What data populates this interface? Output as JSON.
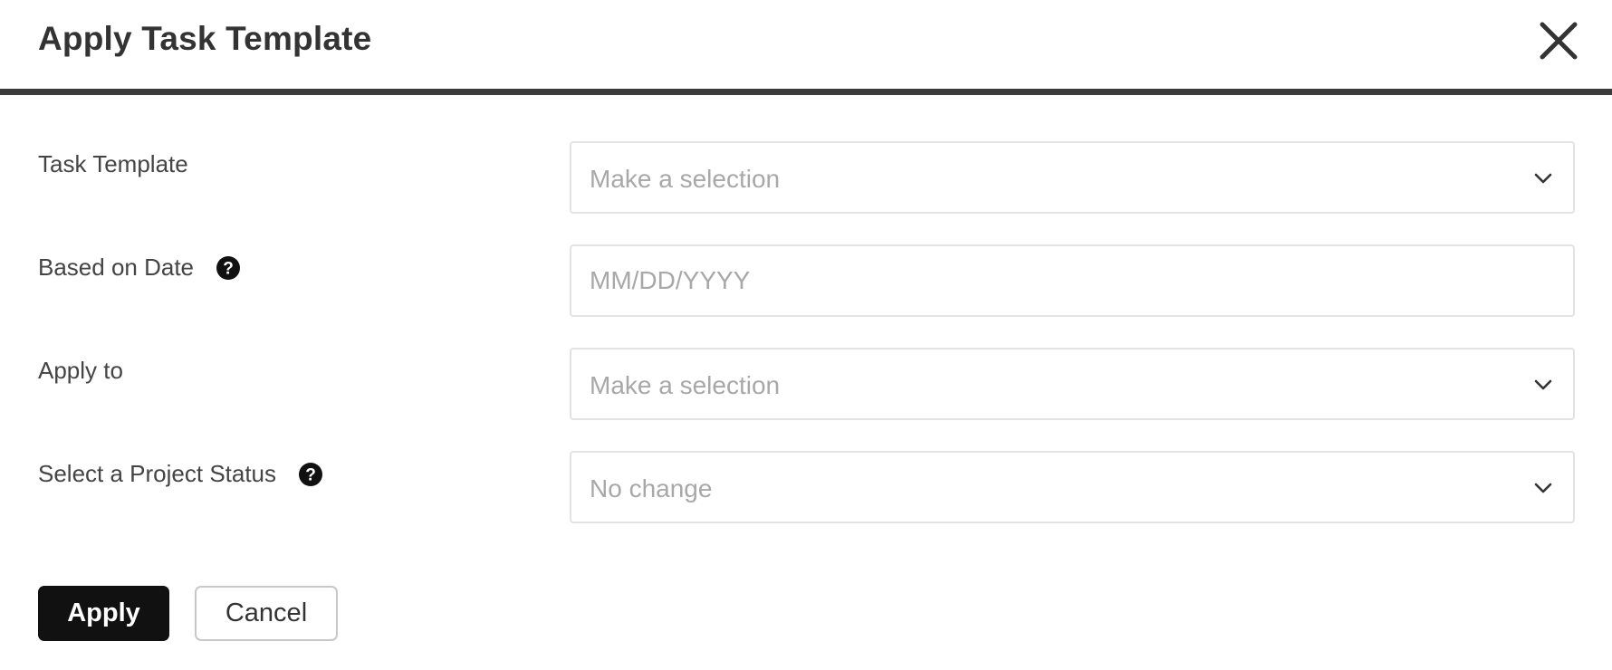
{
  "dialog": {
    "title": "Apply Task Template",
    "close_icon": "close-icon"
  },
  "form": {
    "fields": [
      {
        "label": "Task Template",
        "type": "select",
        "placeholder": "Make a selection",
        "has_help": false
      },
      {
        "label": "Based on Date",
        "type": "date",
        "placeholder": "MM/DD/YYYY",
        "has_help": true
      },
      {
        "label": "Apply to",
        "type": "select",
        "placeholder": "Make a selection",
        "has_help": false
      },
      {
        "label": "Select a Project Status",
        "type": "select",
        "placeholder": "No change",
        "has_help": true
      }
    ]
  },
  "actions": {
    "apply_label": "Apply",
    "cancel_label": "Cancel"
  },
  "colors": {
    "header_rule": "#3a3a3a",
    "primary_button": "#111111",
    "placeholder_text": "#a8a8a8",
    "field_border": "#e3e3e3"
  }
}
